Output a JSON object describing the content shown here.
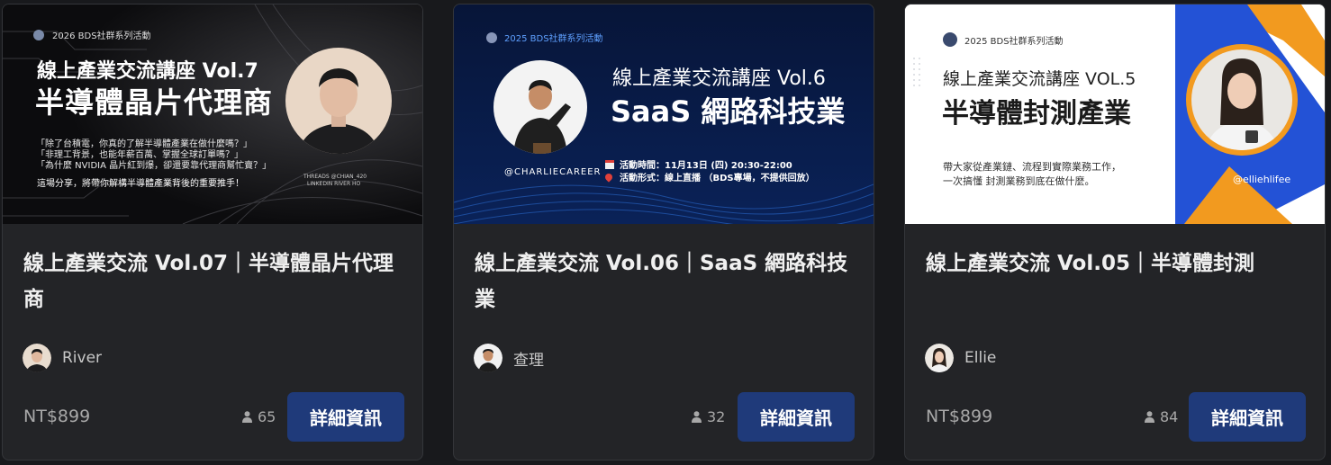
{
  "cards": [
    {
      "banner": {
        "tag": "2026 BDS社群系列活動",
        "title": "線上產業交流講座 Vol.7",
        "subtitle": "半導體晶片代理商",
        "quotes": [
          "「除了台積電，你真的了解半導體產業在做什麼嗎？」",
          "「非理工背景，也能年薪百萬、掌握全球訂單嗎？」",
          "「為什麼 NVIDIA 晶片紅到爆，卻還要靠代理商幫忙賣？」"
        ],
        "summary": "這場分享，將帶你解構半導體產業背後的重要推手！",
        "social": [
          "THREADS @CHIAN_420",
          "LINKEDIN RIVER HO"
        ]
      },
      "title": "線上產業交流 Vol.07｜半導體晶片代理商",
      "author": "River",
      "price": "NT$899",
      "count": "65",
      "button": "詳細資訊"
    },
    {
      "banner": {
        "tag": "2025 BDS社群系列活動",
        "title": "線上產業交流講座 Vol.6",
        "subtitle": "SaaS 網路科技業",
        "handle": "@CHARLIECAREER",
        "time": "活動時間：11月13日 (四) 20:30-22:00",
        "format": "活動形式：線上直播 （BDS專場，不提供回放）"
      },
      "title": "線上產業交流 Vol.06｜SaaS 網路科技業",
      "author": "查理",
      "price": "",
      "count": "32",
      "button": "詳細資訊"
    },
    {
      "banner": {
        "tag": "2025 BDS社群系列活動",
        "title": "線上產業交流講座 VOL.5",
        "subtitle": "半導體封測產業",
        "desc": [
          "帶大家從產業鏈、流程到實際業務工作，",
          "一次搞懂 封測業務到底在做什麼。"
        ],
        "handle": "@elliehlifee"
      },
      "title": "線上產業交流 Vol.05｜半導體封測",
      "author": "Ellie",
      "price": "NT$899",
      "count": "84",
      "button": "詳細資訊"
    }
  ],
  "colors": {
    "page_bg": "#18191c",
    "card_bg": "#232427",
    "button_bg": "#1f3a7a",
    "banner3_blue": "#2352d6",
    "banner3_orange": "#f29a1f"
  },
  "icons": [
    "person-icon",
    "calendar-icon",
    "pin-icon",
    "bds-logo-icon"
  ]
}
